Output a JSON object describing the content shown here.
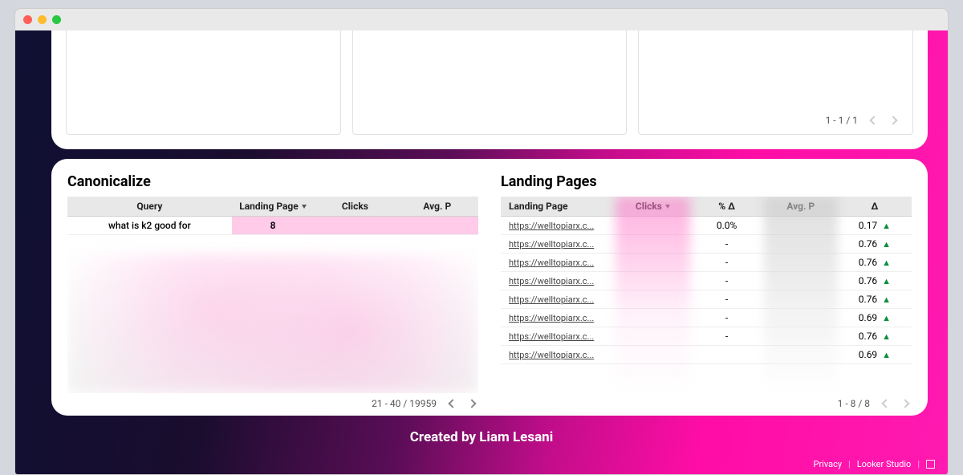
{
  "top_pager": {
    "range": "1 - 1 / 1"
  },
  "canonicalize": {
    "title": "Canonicalize",
    "headers": {
      "query": "Query",
      "landing": "Landing Page",
      "clicks": "Clicks",
      "avgp": "Avg. P"
    },
    "row0": {
      "query": "what is k2 good for",
      "landing": "8",
      "clicks": "",
      "avgp": ""
    },
    "pager": "21 - 40 / 19959"
  },
  "landing": {
    "title": "Landing Pages",
    "headers": {
      "page": "Landing Page",
      "clicks": "Clicks",
      "pct": "% Δ",
      "avgp": "Avg. P",
      "delta": "Δ"
    },
    "rows": [
      {
        "page": "https://welltopiarx.c...",
        "pct": "0.0%",
        "delta": "0.17"
      },
      {
        "page": "https://welltopiarx.c...",
        "pct": "-",
        "delta": "0.76"
      },
      {
        "page": "https://welltopiarx.c...",
        "pct": "-",
        "delta": "0.76"
      },
      {
        "page": "https://welltopiarx.c...",
        "pct": "-",
        "delta": "0.76"
      },
      {
        "page": "https://welltopiarx.c...",
        "pct": "-",
        "delta": "0.76"
      },
      {
        "page": "https://welltopiarx.c...",
        "pct": "-",
        "delta": "0.69"
      },
      {
        "page": "https://welltopiarx.c...",
        "pct": "-",
        "delta": "0.76"
      },
      {
        "page": "https://welltopiarx.c...",
        "pct": "",
        "delta": "0.69"
      }
    ],
    "pager": "1 - 8 / 8"
  },
  "footer": {
    "credit": "Created by Liam Lesani",
    "privacy": "Privacy",
    "product": "Looker Studio"
  }
}
